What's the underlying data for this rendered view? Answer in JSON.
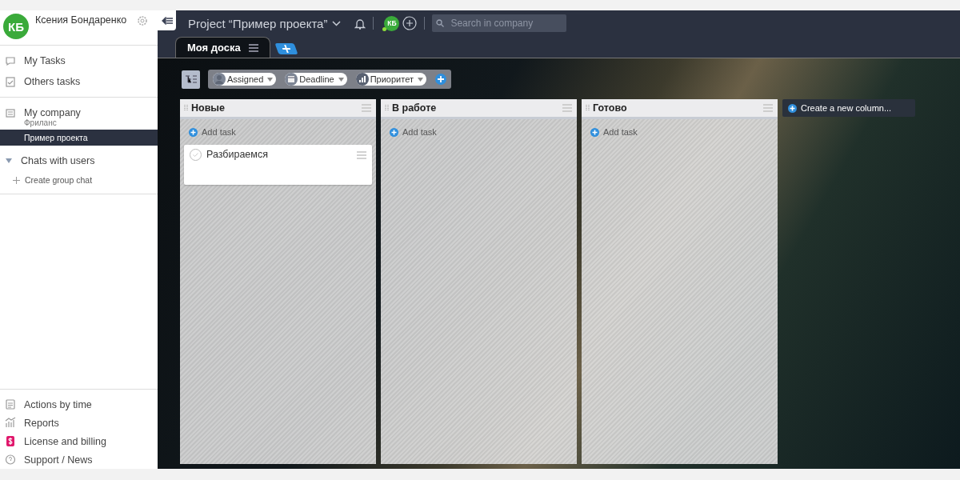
{
  "sidebar": {
    "user": {
      "initials": "КБ",
      "name": "Ксения Бондаренко"
    },
    "nav": [
      {
        "label": "My Tasks",
        "kind": "chat"
      },
      {
        "label": "Others tasks",
        "kind": "clipboard"
      }
    ],
    "company": {
      "name": "My company",
      "subtitle": "Фриланс",
      "projects": [
        {
          "label": "Пример проекта",
          "selected": true
        }
      ]
    },
    "chats": {
      "label": "Chats with users",
      "expanded": true,
      "create_label": "Create group chat"
    },
    "footer": [
      {
        "label": "Actions by time",
        "kind": "list"
      },
      {
        "label": "Reports",
        "kind": "chart"
      },
      {
        "label": "License and billing",
        "kind": "billing"
      },
      {
        "label": "Support / News",
        "kind": "help"
      }
    ]
  },
  "header": {
    "title": "Project “Пример проекта”",
    "member_initials": "КБ",
    "search": {
      "placeholder": "Search in company"
    }
  },
  "tabs": [
    {
      "label": "Моя доска",
      "selected": true
    }
  ],
  "filters": [
    {
      "label": "Assigned",
      "kind": "person"
    },
    {
      "label": "Deadline",
      "kind": "calendar"
    },
    {
      "label": "Приоритет",
      "kind": "bars"
    }
  ],
  "columns": [
    {
      "title": "Новые",
      "add_label": "Add task",
      "tasks": [
        {
          "title": "Разбираемся",
          "done": false
        }
      ]
    },
    {
      "title": "В работе",
      "add_label": "Add task"
    },
    {
      "title": "Готово",
      "add_label": "Add task"
    }
  ],
  "new_column_label": "Create a new column..."
}
